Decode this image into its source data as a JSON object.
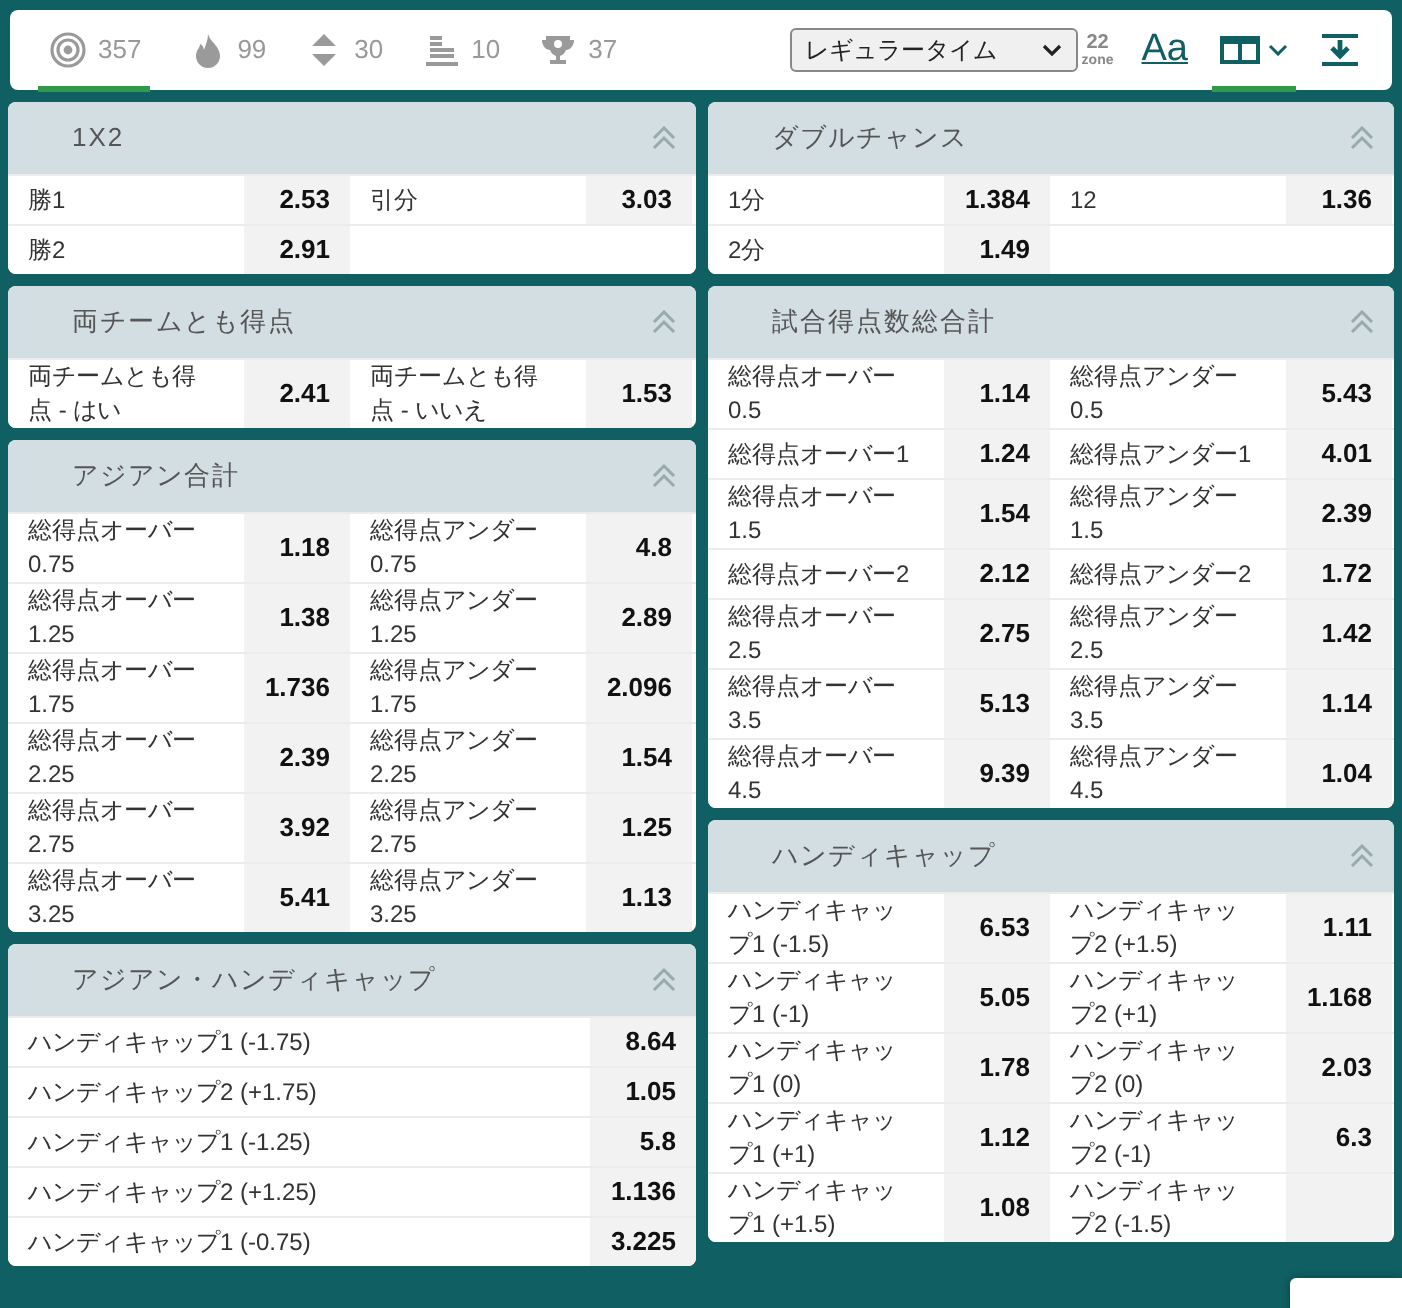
{
  "top_bar": {
    "filters": [
      {
        "kind": "target",
        "count": "357",
        "selected": true
      },
      {
        "kind": "fire",
        "count": "99",
        "selected": false
      },
      {
        "kind": "updown",
        "count": "30",
        "selected": false
      },
      {
        "kind": "bars",
        "count": "10",
        "selected": false
      },
      {
        "kind": "trophy",
        "count": "37",
        "selected": false
      }
    ],
    "period_select": {
      "value": "レギュラータイム"
    },
    "tools": [
      {
        "kind": "zone",
        "number": "22",
        "word": "zone",
        "selected": false
      },
      {
        "kind": "font",
        "text": "Aa",
        "selected": false
      },
      {
        "kind": "layout",
        "selected": true
      },
      {
        "kind": "download",
        "selected": false
      }
    ]
  },
  "columns": [
    [
      {
        "title": "1X2",
        "kind": "grid",
        "expanded": true,
        "outcomes": [
          {
            "label": "勝1",
            "odds": "2.53"
          },
          {
            "label": "引分",
            "odds": "3.03"
          },
          {
            "label": "勝2",
            "odds": "2.91"
          }
        ]
      },
      {
        "title": "両チームとも得点",
        "kind": "grid",
        "expanded": true,
        "outcomes": [
          {
            "label": "両チームとも得点 - はい",
            "odds": "2.41"
          },
          {
            "label": "両チームとも得点 - いいえ",
            "odds": "1.53"
          }
        ]
      },
      {
        "title": "アジアン合計",
        "kind": "grid",
        "expanded": true,
        "outcomes": [
          {
            "label": "総得点オーバー0.75",
            "odds": "1.18"
          },
          {
            "label": "総得点アンダー0.75",
            "odds": "4.8"
          },
          {
            "label": "総得点オーバー1.25",
            "odds": "1.38"
          },
          {
            "label": "総得点アンダー1.25",
            "odds": "2.89"
          },
          {
            "label": "総得点オーバー1.75",
            "odds": "1.736"
          },
          {
            "label": "総得点アンダー1.75",
            "odds": "2.096"
          },
          {
            "label": "総得点オーバー2.25",
            "odds": "2.39"
          },
          {
            "label": "総得点アンダー2.25",
            "odds": "1.54"
          },
          {
            "label": "総得点オーバー2.75",
            "odds": "3.92"
          },
          {
            "label": "総得点アンダー2.75",
            "odds": "1.25"
          },
          {
            "label": "総得点オーバー3.25",
            "odds": "5.41"
          },
          {
            "label": "総得点アンダー3.25",
            "odds": "1.13"
          }
        ]
      },
      {
        "title": "アジアン・ハンディキャップ",
        "kind": "list",
        "expanded": true,
        "outcomes": [
          {
            "label": "ハンディキャップ1 (-1.75)",
            "odds": "8.64"
          },
          {
            "label": "ハンディキャップ2 (+1.75)",
            "odds": "1.05"
          },
          {
            "label": "ハンディキャップ1 (-1.25)",
            "odds": "5.8"
          },
          {
            "label": "ハンディキャップ2 (+1.25)",
            "odds": "1.136"
          },
          {
            "label": "ハンディキャップ1 (-0.75)",
            "odds": "3.225"
          }
        ]
      }
    ],
    [
      {
        "title": "ダブルチャンス",
        "kind": "grid",
        "expanded": true,
        "outcomes": [
          {
            "label": "1分",
            "odds": "1.384"
          },
          {
            "label": "12",
            "odds": "1.36"
          },
          {
            "label": "2分",
            "odds": "1.49"
          }
        ]
      },
      {
        "title": "試合得点数総合計",
        "kind": "grid",
        "expanded": true,
        "outcomes": [
          {
            "label": "総得点オーバー0.5",
            "odds": "1.14"
          },
          {
            "label": "総得点アンダー0.5",
            "odds": "5.43"
          },
          {
            "label": "総得点オーバー1",
            "odds": "1.24"
          },
          {
            "label": "総得点アンダー1",
            "odds": "4.01"
          },
          {
            "label": "総得点オーバー1.5",
            "odds": "1.54"
          },
          {
            "label": "総得点アンダー1.5",
            "odds": "2.39"
          },
          {
            "label": "総得点オーバー2",
            "odds": "2.12"
          },
          {
            "label": "総得点アンダー2",
            "odds": "1.72"
          },
          {
            "label": "総得点オーバー2.5",
            "odds": "2.75"
          },
          {
            "label": "総得点アンダー2.5",
            "odds": "1.42"
          },
          {
            "label": "総得点オーバー3.5",
            "odds": "5.13"
          },
          {
            "label": "総得点アンダー3.5",
            "odds": "1.14"
          },
          {
            "label": "総得点オーバー4.5",
            "odds": "9.39"
          },
          {
            "label": "総得点アンダー4.5",
            "odds": "1.04"
          }
        ]
      },
      {
        "title": "ハンディキャップ",
        "kind": "grid",
        "expanded": true,
        "outcomes": [
          {
            "label": "ハンディキャップ1 (-1.5)",
            "odds": "6.53"
          },
          {
            "label": "ハンディキャップ2 (+1.5)",
            "odds": "1.11"
          },
          {
            "label": "ハンディキャップ1 (-1)",
            "odds": "5.05"
          },
          {
            "label": "ハンディキャップ2 (+1)",
            "odds": "1.168"
          },
          {
            "label": "ハンディキャップ1 (0)",
            "odds": "1.78"
          },
          {
            "label": "ハンディキャップ2 (0)",
            "odds": "2.03"
          },
          {
            "label": "ハンディキャップ1 (+1)",
            "odds": "1.12"
          },
          {
            "label": "ハンディキャップ2 (-1)",
            "odds": "6.3"
          },
          {
            "label": "ハンディキャップ1 (+1.5)",
            "odds": "1.08"
          },
          {
            "label": "ハンディキャップ2 (-1.5)"
          }
        ]
      }
    ]
  ],
  "overlay": {
    "kind": "panel"
  }
}
